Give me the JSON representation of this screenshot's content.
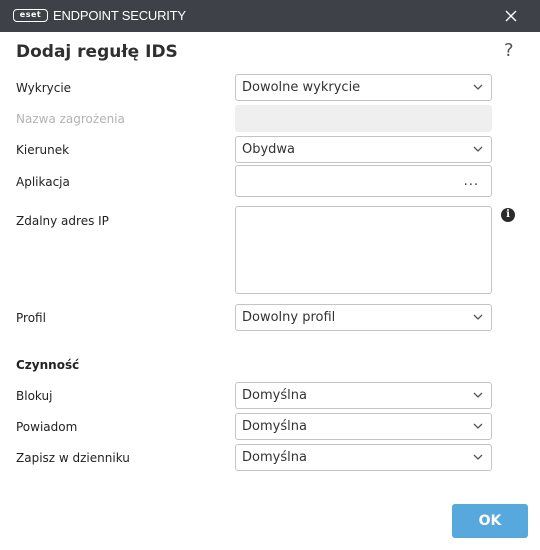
{
  "titlebar": {
    "logo_text": "eset",
    "product_name": "ENDPOINT SECURITY",
    "close_icon": "close-icon"
  },
  "dialog": {
    "title": "Dodaj regułę IDS",
    "help_icon": "?"
  },
  "fields": {
    "detection": {
      "label": "Wykrycie",
      "value": "Dowolne wykrycie"
    },
    "threat_name": {
      "label": "Nazwa zagrożenia",
      "value": ""
    },
    "direction": {
      "label": "Kierunek",
      "value": "Obydwa"
    },
    "application": {
      "label": "Aplikacja",
      "value": "",
      "browse": "..."
    },
    "remote_ip": {
      "label": "Zdalny adres IP",
      "value": ""
    },
    "profile": {
      "label": "Profil",
      "value": "Dowolny profil"
    }
  },
  "action": {
    "heading": "Czynność",
    "block": {
      "label": "Blokuj",
      "value": "Domyślna"
    },
    "notify": {
      "label": "Powiadom",
      "value": "Domyślna"
    },
    "log": {
      "label": "Zapisz w dzienniku",
      "value": "Domyślna"
    }
  },
  "buttons": {
    "ok": "OK"
  },
  "colors": {
    "titlebar": "#3e4147",
    "ok_button": "#56a8dd",
    "disabled_field": "#efefef"
  }
}
